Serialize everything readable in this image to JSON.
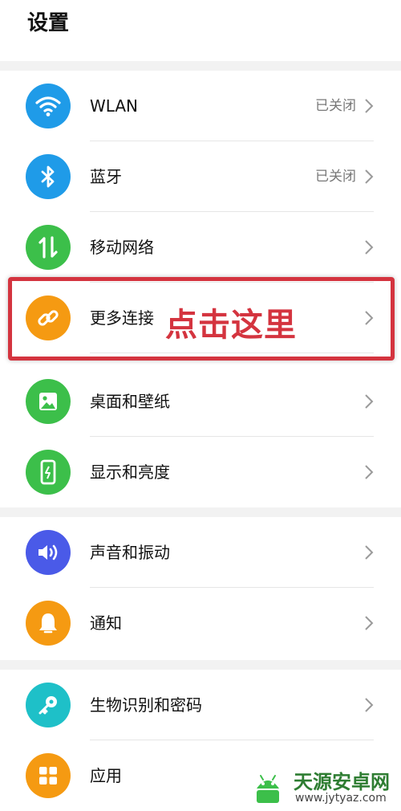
{
  "header": {
    "title": "设置"
  },
  "colors": {
    "wlan": "#1f9be8",
    "bluetooth": "#1f9be8",
    "mobile": "#3cbf4a",
    "more": "#f59a12",
    "wallpaper": "#3cbf4a",
    "display": "#3cbf4a",
    "sound": "#4a5ae8",
    "notify": "#f59a12",
    "biometric": "#1ec0c8",
    "apps": "#f59a12",
    "highlight": "#d4343f"
  },
  "groups": [
    {
      "items": [
        {
          "label": "WLAN",
          "status": "已关闭",
          "icon": "wifi-icon"
        },
        {
          "label": "蓝牙",
          "status": "已关闭",
          "icon": "bluetooth-icon"
        },
        {
          "label": "移动网络",
          "status": "",
          "icon": "mobile-data-icon"
        },
        {
          "label": "更多连接",
          "status": "",
          "icon": "link-icon"
        },
        {
          "label": "桌面和壁纸",
          "status": "",
          "icon": "image-icon"
        },
        {
          "label": "显示和亮度",
          "status": "",
          "icon": "phone-brightness-icon"
        }
      ]
    },
    {
      "items": [
        {
          "label": "声音和振动",
          "status": "",
          "icon": "speaker-icon"
        },
        {
          "label": "通知",
          "status": "",
          "icon": "bell-icon"
        }
      ]
    },
    {
      "items": [
        {
          "label": "生物识别和密码",
          "status": "",
          "icon": "key-icon"
        },
        {
          "label": "应用",
          "status": "",
          "icon": "apps-grid-icon"
        }
      ]
    }
  ],
  "annotation": {
    "text": "点击这里"
  },
  "watermark": {
    "title": "天源安卓网",
    "url": "www.jytyaz.com"
  }
}
